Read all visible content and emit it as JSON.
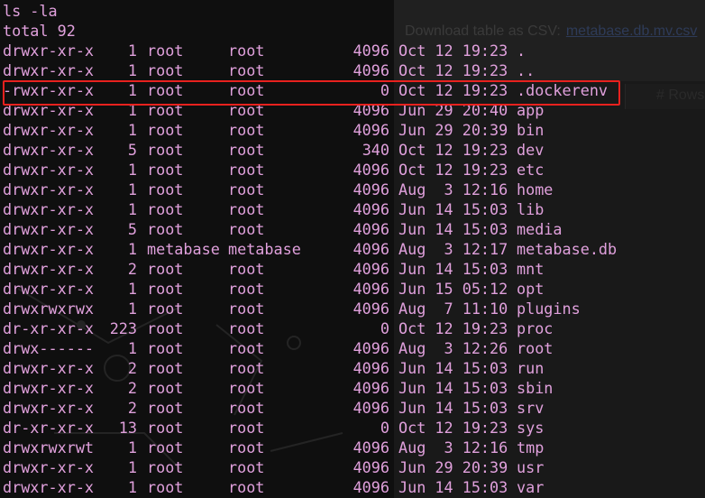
{
  "terminal": {
    "command": "ls -la",
    "total": "total 92",
    "entries": [
      {
        "perms": "drwxr-xr-x",
        "links": "1",
        "owner": "root",
        "group": "root",
        "size": "4096",
        "date": "Oct 12 19:23",
        "name": "."
      },
      {
        "perms": "drwxr-xr-x",
        "links": "1",
        "owner": "root",
        "group": "root",
        "size": "4096",
        "date": "Oct 12 19:23",
        "name": ".."
      },
      {
        "perms": "-rwxr-xr-x",
        "links": "1",
        "owner": "root",
        "group": "root",
        "size": "0",
        "date": "Oct 12 19:23",
        "name": ".dockerenv"
      },
      {
        "perms": "drwxr-xr-x",
        "links": "1",
        "owner": "root",
        "group": "root",
        "size": "4096",
        "date": "Jun 29 20:40",
        "name": "app"
      },
      {
        "perms": "drwxr-xr-x",
        "links": "1",
        "owner": "root",
        "group": "root",
        "size": "4096",
        "date": "Jun 29 20:39",
        "name": "bin"
      },
      {
        "perms": "drwxr-xr-x",
        "links": "5",
        "owner": "root",
        "group": "root",
        "size": "340",
        "date": "Oct 12 19:23",
        "name": "dev"
      },
      {
        "perms": "drwxr-xr-x",
        "links": "1",
        "owner": "root",
        "group": "root",
        "size": "4096",
        "date": "Oct 12 19:23",
        "name": "etc"
      },
      {
        "perms": "drwxr-xr-x",
        "links": "1",
        "owner": "root",
        "group": "root",
        "size": "4096",
        "date": "Aug  3 12:16",
        "name": "home"
      },
      {
        "perms": "drwxr-xr-x",
        "links": "1",
        "owner": "root",
        "group": "root",
        "size": "4096",
        "date": "Jun 14 15:03",
        "name": "lib"
      },
      {
        "perms": "drwxr-xr-x",
        "links": "5",
        "owner": "root",
        "group": "root",
        "size": "4096",
        "date": "Jun 14 15:03",
        "name": "media"
      },
      {
        "perms": "drwxr-xr-x",
        "links": "1",
        "owner": "metabase",
        "group": "metabase",
        "size": "4096",
        "date": "Aug  3 12:17",
        "name": "metabase.db"
      },
      {
        "perms": "drwxr-xr-x",
        "links": "2",
        "owner": "root",
        "group": "root",
        "size": "4096",
        "date": "Jun 14 15:03",
        "name": "mnt"
      },
      {
        "perms": "drwxr-xr-x",
        "links": "1",
        "owner": "root",
        "group": "root",
        "size": "4096",
        "date": "Jun 15 05:12",
        "name": "opt"
      },
      {
        "perms": "drwxrwxrwx",
        "links": "1",
        "owner": "root",
        "group": "root",
        "size": "4096",
        "date": "Aug  7 11:10",
        "name": "plugins"
      },
      {
        "perms": "dr-xr-xr-x",
        "links": "223",
        "owner": "root",
        "group": "root",
        "size": "0",
        "date": "Oct 12 19:23",
        "name": "proc"
      },
      {
        "perms": "drwx------",
        "links": "1",
        "owner": "root",
        "group": "root",
        "size": "4096",
        "date": "Aug  3 12:26",
        "name": "root"
      },
      {
        "perms": "drwxr-xr-x",
        "links": "2",
        "owner": "root",
        "group": "root",
        "size": "4096",
        "date": "Jun 14 15:03",
        "name": "run"
      },
      {
        "perms": "drwxr-xr-x",
        "links": "2",
        "owner": "root",
        "group": "root",
        "size": "4096",
        "date": "Jun 14 15:03",
        "name": "sbin"
      },
      {
        "perms": "drwxr-xr-x",
        "links": "2",
        "owner": "root",
        "group": "root",
        "size": "4096",
        "date": "Jun 14 15:03",
        "name": "srv"
      },
      {
        "perms": "dr-xr-xr-x",
        "links": "13",
        "owner": "root",
        "group": "root",
        "size": "0",
        "date": "Oct 12 19:23",
        "name": "sys"
      },
      {
        "perms": "drwxrwxrwt",
        "links": "1",
        "owner": "root",
        "group": "root",
        "size": "4096",
        "date": "Aug  3 12:16",
        "name": "tmp"
      },
      {
        "perms": "drwxr-xr-x",
        "links": "1",
        "owner": "root",
        "group": "root",
        "size": "4096",
        "date": "Jun 29 20:39",
        "name": "usr"
      },
      {
        "perms": "drwxr-xr-x",
        "links": "1",
        "owner": "root",
        "group": "root",
        "size": "4096",
        "date": "Jun 14 15:03",
        "name": "var"
      }
    ],
    "highlighted_entry": ".dockerenv",
    "text_color": "#e0a0dc",
    "highlight_color": "#e8211e"
  },
  "background_page": {
    "csv_label": "Download table as CSV:",
    "csv_link": "metabase.db.mv.csv",
    "rows_label": "# Rows"
  }
}
